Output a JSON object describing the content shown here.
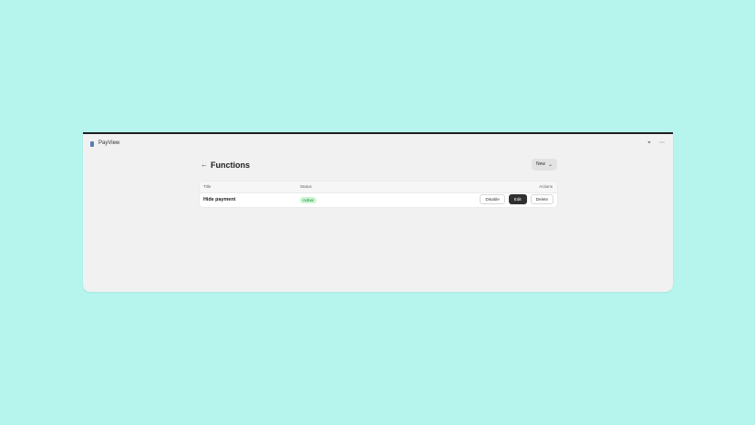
{
  "app": {
    "title": "PayView"
  },
  "header": {
    "title": "Functions",
    "new_label": "New"
  },
  "table": {
    "headers": {
      "title": "Title",
      "status": "Status",
      "actions": "Actions"
    },
    "rows": [
      {
        "title": "Hide payment",
        "status": "Active",
        "actions": {
          "disable": "Disable",
          "edit": "Edit",
          "delete": "Delete"
        }
      }
    ]
  },
  "icons": {
    "app": "app-icon",
    "pin": "pin-icon",
    "more": "more-icon",
    "back": "arrow-left-icon",
    "chevron": "chevron-down-icon"
  },
  "colors": {
    "background": "#b6f4ee",
    "window": "#f1f1f1",
    "card": "#ffffff",
    "badge_bg": "#cdf7d4",
    "badge_text": "#0f7d2f",
    "primary_button": "#303030"
  }
}
